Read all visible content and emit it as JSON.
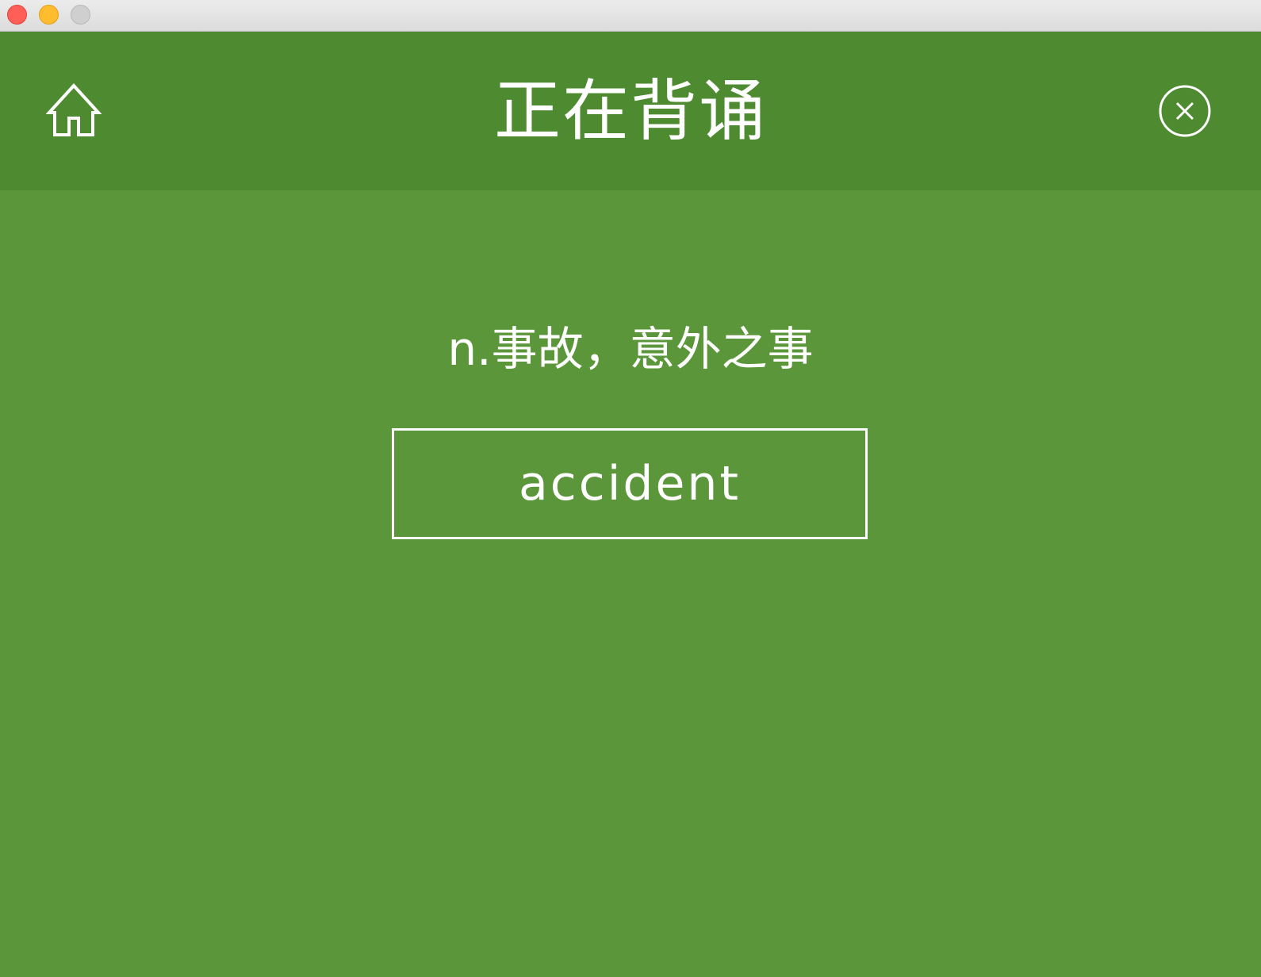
{
  "window": {
    "controls": [
      "close",
      "minimize",
      "maximize"
    ]
  },
  "header": {
    "title": "正在背诵",
    "home_icon": "home-icon",
    "close_icon": "close-circle-icon"
  },
  "card": {
    "definition": "n.事故，意外之事",
    "answer_value": "accident"
  },
  "colors": {
    "header_bg": "#4e8a30",
    "content_bg": "#5b973a",
    "text": "#ffffff"
  }
}
